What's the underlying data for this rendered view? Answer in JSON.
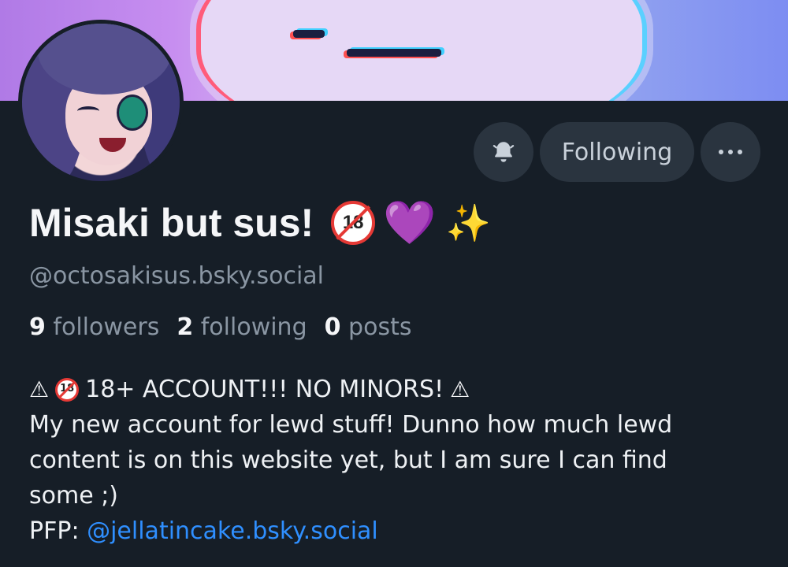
{
  "profile": {
    "display_name": "Misaki but sus!",
    "name_emoji": [
      "under-18",
      "purple-heart",
      "sparkles"
    ],
    "under18_text": "18",
    "heart_glyph": "💜",
    "sparkles_glyph": "✨",
    "handle": "@octosakisus.bsky.social"
  },
  "actions": {
    "following_label": "Following"
  },
  "stats": {
    "followers_count": "9",
    "followers_label": "followers",
    "following_count": "2",
    "following_label": "following",
    "posts_count": "0",
    "posts_label": "posts"
  },
  "bio": {
    "warning_glyph": "⚠",
    "line1_text": "18+ ACCOUNT!!! NO MINORS!",
    "line2": "My new account for lewd stuff! Dunno how much lewd",
    "line3": "content is on this website yet, but I am sure I can find",
    "line4": "some ;)",
    "pfp_label": "PFP:",
    "pfp_link": "@jellatincake.bsky.social"
  },
  "colors": {
    "background": "#161e27",
    "link": "#2f8fff",
    "muted": "#8a96a3",
    "button_bg": "#2a343f"
  }
}
